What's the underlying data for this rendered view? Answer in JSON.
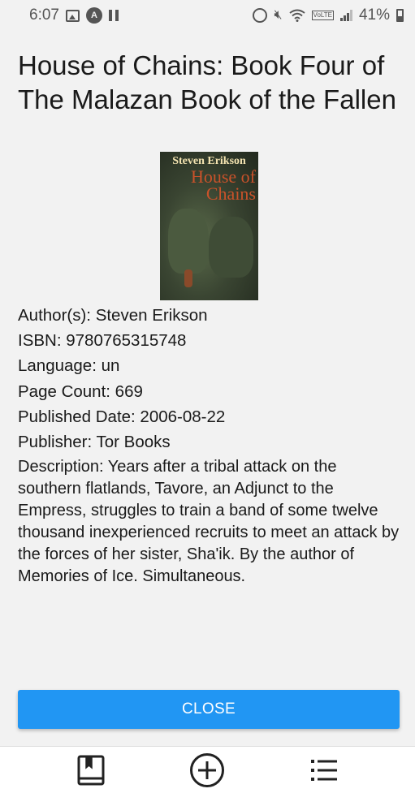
{
  "status_bar": {
    "time": "6:07",
    "battery_percent": "41%",
    "network_label": "VoLTE",
    "icons": [
      "image-icon",
      "a-circle-icon",
      "pause-icon",
      "alarm-icon",
      "mute-icon",
      "wifi-icon",
      "volte-icon",
      "signal-icon",
      "battery-icon"
    ]
  },
  "book": {
    "title": "House of Chains: Book Four of The Malazan Book of the Fallen",
    "cover": {
      "author_text": "Steven Erikson",
      "title_text": "House of Chains"
    },
    "details": [
      "Author(s): Steven Erikson",
      "ISBN: 9780765315748",
      "Language: un",
      "Page Count: 669",
      "Published Date: 2006-08-22",
      "Publisher: Tor Books"
    ],
    "description": "Description: Years after a tribal attack on the southern flatlands, Tavore, an Adjunct to the Empress, struggles to train a band of some twelve thousand inexperienced recruits to meet an attack by the forces of her sister, Sha'ik. By the author of Memories of Ice. Simultaneous."
  },
  "actions": {
    "close_label": "CLOSE"
  },
  "bottom_nav": {
    "items": [
      "book-icon",
      "add-circle-icon",
      "list-icon"
    ]
  },
  "colors": {
    "accent": "#2196f3",
    "background": "#f2f2f2",
    "nav_background": "#ffffff"
  }
}
